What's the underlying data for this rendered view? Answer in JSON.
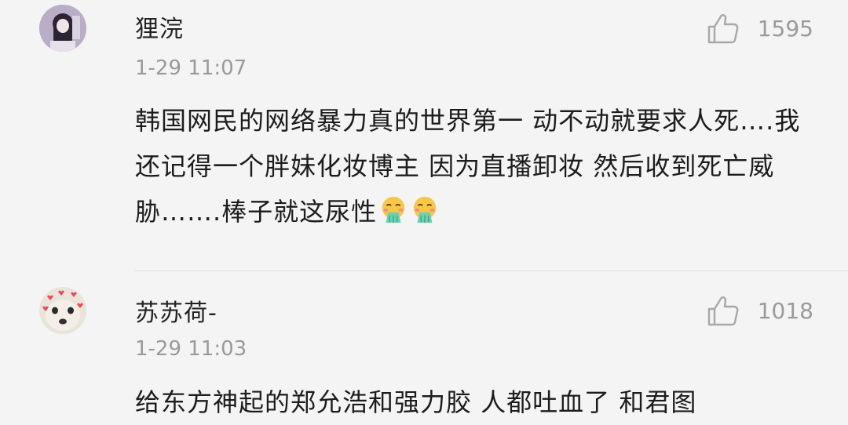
{
  "comments": [
    {
      "username": "狸浣",
      "time": "1-29 11:07",
      "likes": "1595",
      "text": "韩国网民的网络暴力真的世界第一 动不动就要求人死….我还记得一个胖妹化妆博主 因为直播卸妆 然后收到死亡威胁…….棒子就这尿性",
      "emojis": [
        "vomiting-face-emoji",
        "vomiting-face-emoji"
      ]
    },
    {
      "username": "苏苏荷-",
      "time": "1-29 11:03",
      "likes": "1018",
      "text": "给东方神起的郑允浩和强力胶 人都吐血了 和君图"
    }
  ],
  "icons": {
    "like": "thumbs-up-icon"
  },
  "colors": {
    "background": "#f4f4f4",
    "secondary_text": "#9a9a9a",
    "primary_text": "#1c1c1c",
    "divider": "#dedede"
  }
}
